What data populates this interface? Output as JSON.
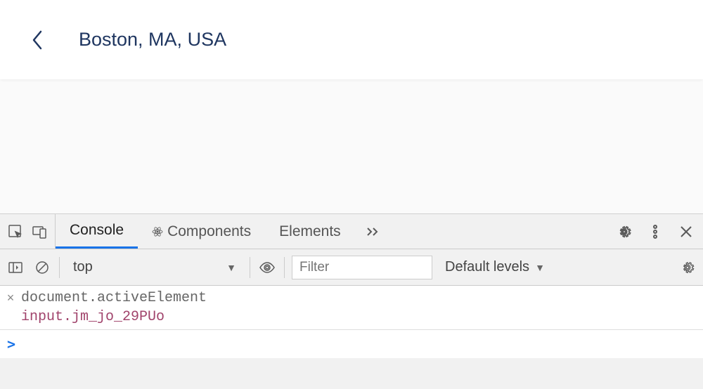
{
  "header": {
    "location_value": "Boston, MA, USA"
  },
  "devtools": {
    "tabs": {
      "console": "Console",
      "components": "Components",
      "elements": "Elements"
    },
    "toolbar": {
      "context": "top",
      "filter_placeholder": "Filter",
      "levels_label": "Default levels"
    },
    "log": {
      "expression": "document.activeElement",
      "result": "input.jm_jo_29PUo"
    },
    "prompt": ">"
  }
}
